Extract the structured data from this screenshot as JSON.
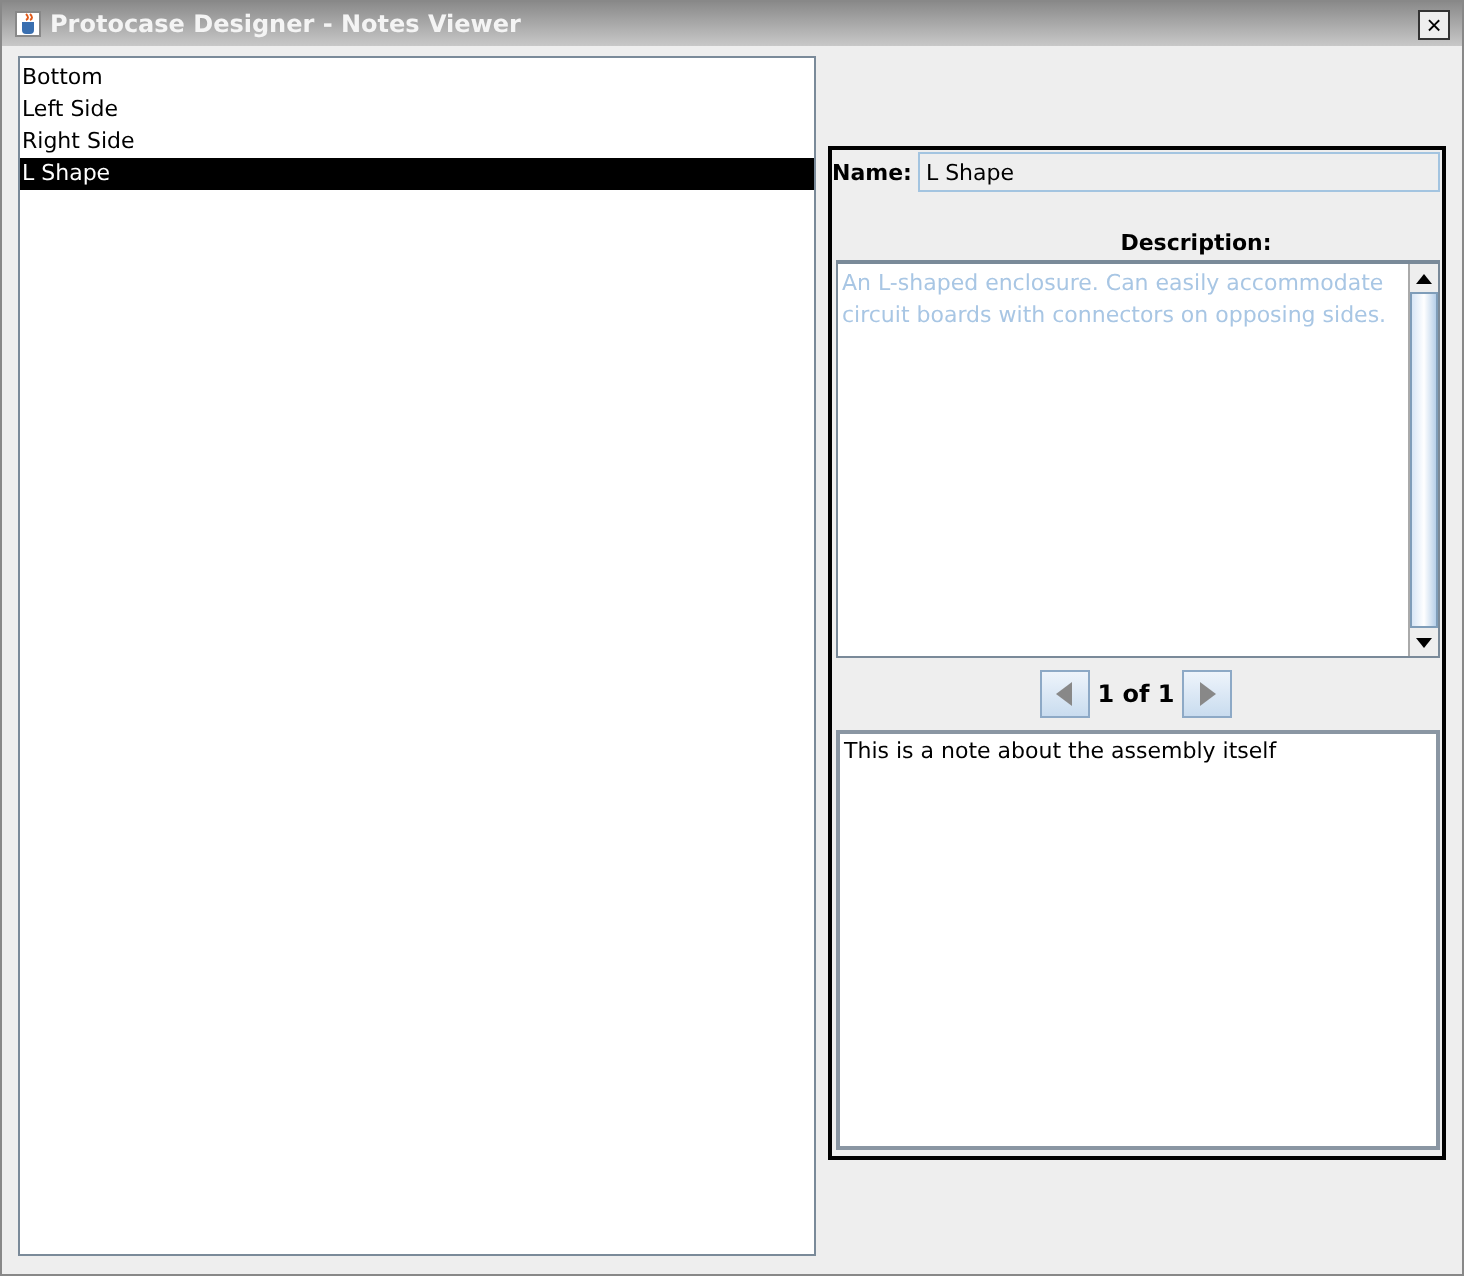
{
  "window": {
    "title": "Protocase Designer - Notes Viewer",
    "close": "×"
  },
  "list": {
    "items": [
      {
        "label": "Bottom",
        "selected": false
      },
      {
        "label": "Left Side",
        "selected": false
      },
      {
        "label": "Right Side",
        "selected": false
      },
      {
        "label": "L Shape",
        "selected": true
      }
    ]
  },
  "details": {
    "name_label": "Name:",
    "name_value": "L Shape",
    "description_label": "Description:",
    "description": "An L-shaped enclosure. Can easily accommodate circuit boards with connectors on opposing sides.",
    "pager": "1 of 1",
    "note": "This is a note about the assembly itself"
  }
}
